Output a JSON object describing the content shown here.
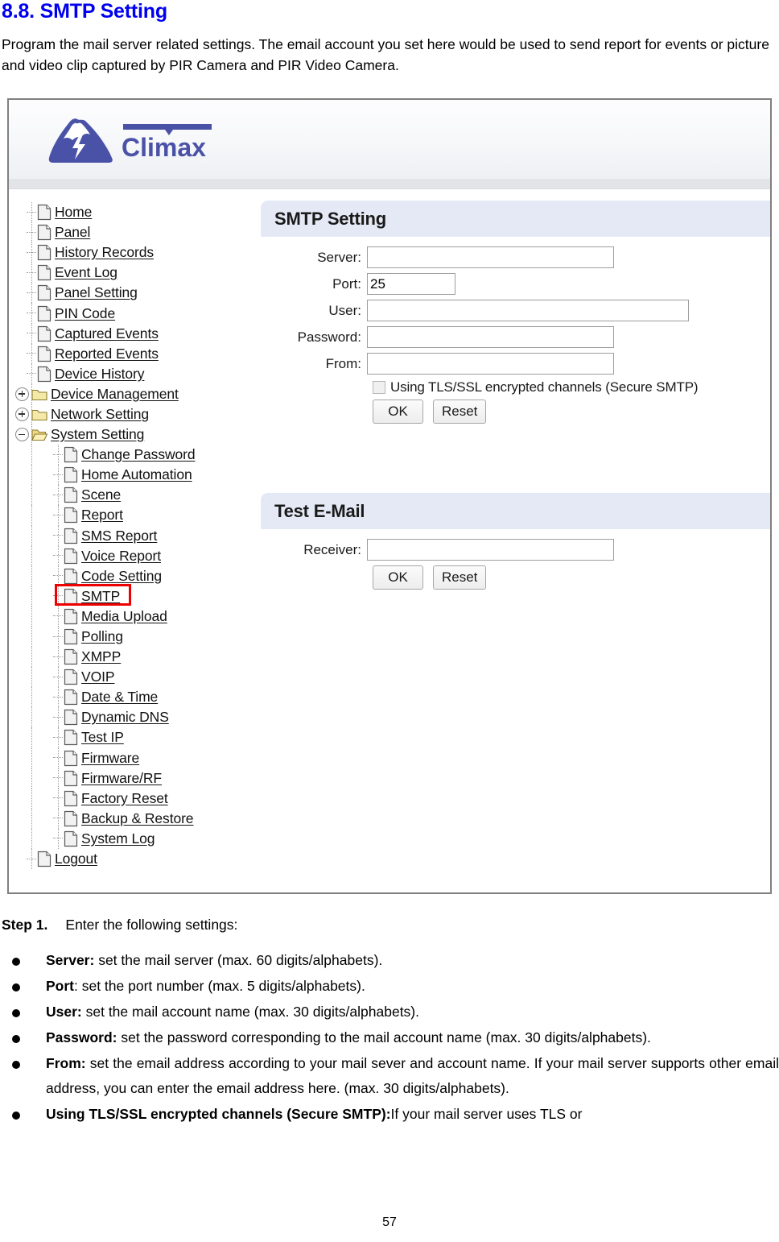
{
  "document": {
    "title": "8.8. SMTP Setting",
    "intro": "Program the mail server related settings. The email account you set here would be used to send report for events or picture and video clip captured by PIR Camera and PIR Video Camera.",
    "page_number": "57",
    "title_color": "#0000ee"
  },
  "screenshot": {
    "brand": {
      "name": "Climax",
      "logo_icon": "mountain-lightning-icon",
      "color": "#4a52a8"
    },
    "nav_tree": {
      "items": [
        {
          "label": "Home",
          "icon": "page-icon",
          "level": 1,
          "type": "leaf"
        },
        {
          "label": "Panel",
          "icon": "page-icon",
          "level": 1,
          "type": "leaf"
        },
        {
          "label": "History Records",
          "icon": "page-icon",
          "level": 1,
          "type": "leaf"
        },
        {
          "label": "Event Log",
          "icon": "page-icon",
          "level": 1,
          "type": "leaf"
        },
        {
          "label": "Panel Setting",
          "icon": "page-icon",
          "level": 1,
          "type": "leaf"
        },
        {
          "label": "PIN Code",
          "icon": "page-icon",
          "level": 1,
          "type": "leaf"
        },
        {
          "label": "Captured Events",
          "icon": "page-icon",
          "level": 1,
          "type": "leaf"
        },
        {
          "label": "Reported Events",
          "icon": "page-icon",
          "level": 1,
          "type": "leaf"
        },
        {
          "label": "Device History",
          "icon": "page-icon",
          "level": 1,
          "type": "leaf"
        },
        {
          "label": "Device Management",
          "icon": "folder-closed-icon",
          "level": 1,
          "type": "folder",
          "expander": "plus"
        },
        {
          "label": "Network Setting",
          "icon": "folder-closed-icon",
          "level": 1,
          "type": "folder",
          "expander": "plus"
        },
        {
          "label": "System Setting",
          "icon": "folder-open-icon",
          "level": 1,
          "type": "folder",
          "expander": "minus"
        },
        {
          "label": "Change Password",
          "icon": "page-icon",
          "level": 2,
          "type": "leaf"
        },
        {
          "label": "Home Automation",
          "icon": "page-icon",
          "level": 2,
          "type": "leaf"
        },
        {
          "label": "Scene",
          "icon": "page-icon",
          "level": 2,
          "type": "leaf"
        },
        {
          "label": "Report",
          "icon": "page-icon",
          "level": 2,
          "type": "leaf"
        },
        {
          "label": "SMS Report",
          "icon": "page-icon",
          "level": 2,
          "type": "leaf"
        },
        {
          "label": "Voice Report",
          "icon": "page-icon",
          "level": 2,
          "type": "leaf"
        },
        {
          "label": "Code Setting",
          "icon": "page-icon",
          "level": 2,
          "type": "leaf"
        },
        {
          "label": "SMTP",
          "icon": "page-icon",
          "level": 2,
          "type": "leaf",
          "highlighted": true
        },
        {
          "label": "Media Upload",
          "icon": "page-icon",
          "level": 2,
          "type": "leaf"
        },
        {
          "label": "Polling",
          "icon": "page-icon",
          "level": 2,
          "type": "leaf"
        },
        {
          "label": "XMPP",
          "icon": "page-icon",
          "level": 2,
          "type": "leaf"
        },
        {
          "label": "VOIP",
          "icon": "page-icon",
          "level": 2,
          "type": "leaf"
        },
        {
          "label": "Date & Time",
          "icon": "page-icon",
          "level": 2,
          "type": "leaf"
        },
        {
          "label": "Dynamic DNS",
          "icon": "page-icon",
          "level": 2,
          "type": "leaf"
        },
        {
          "label": "Test IP",
          "icon": "page-icon",
          "level": 2,
          "type": "leaf"
        },
        {
          "label": "Firmware",
          "icon": "page-icon",
          "level": 2,
          "type": "leaf"
        },
        {
          "label": "Firmware/RF",
          "icon": "page-icon",
          "level": 2,
          "type": "leaf"
        },
        {
          "label": "Factory Reset",
          "icon": "page-icon",
          "level": 2,
          "type": "leaf"
        },
        {
          "label": "Backup & Restore",
          "icon": "page-icon",
          "level": 2,
          "type": "leaf"
        },
        {
          "label": "System Log",
          "icon": "page-icon",
          "level": 2,
          "type": "leaf"
        },
        {
          "label": "Logout",
          "icon": "page-icon",
          "level": 1,
          "type": "leaf"
        }
      ],
      "highlight_color": "#ee0000"
    },
    "smtp_panel": {
      "title": "SMTP Setting",
      "header_color": "#e4e9f5",
      "fields": {
        "server": {
          "label": "Server:",
          "value": ""
        },
        "port": {
          "label": "Port:",
          "value": "25"
        },
        "user": {
          "label": "User:",
          "value": ""
        },
        "password": {
          "label": "Password:",
          "value": ""
        },
        "from": {
          "label": "From:",
          "value": ""
        }
      },
      "checkbox": {
        "label": "Using TLS/SSL encrypted channels (Secure SMTP)",
        "checked": false
      },
      "buttons": {
        "ok": "OK",
        "reset": "Reset"
      }
    },
    "test_email_panel": {
      "title": "Test E-Mail",
      "header_color": "#e4e9f5",
      "fields": {
        "receiver": {
          "label": "Receiver:",
          "value": ""
        }
      },
      "buttons": {
        "ok": "OK",
        "reset": "Reset"
      }
    }
  },
  "instructions": {
    "step_label": "Step 1.",
    "step_text": "Enter the following settings:",
    "bullets": [
      {
        "term": "Server:",
        "text": " set the mail server (max. 60 digits/alphabets)."
      },
      {
        "term": "Port",
        "text": ": set the port number (max. 5 digits/alphabets)."
      },
      {
        "term": "User:",
        "text": " set the mail account name (max. 30 digits/alphabets)."
      },
      {
        "term": "Password:",
        "text": " set the password corresponding to the mail account name (max. 30 digits/alphabets)."
      },
      {
        "term": "From:",
        "text": " set the email address according to your mail sever and account name. If your mail server supports other email address, you can enter the email address here. (max. 30 digits/alphabets)."
      },
      {
        "term": "Using TLS/SSL encrypted channels (Secure SMTP):",
        "text": "If your mail server uses TLS or"
      }
    ]
  }
}
